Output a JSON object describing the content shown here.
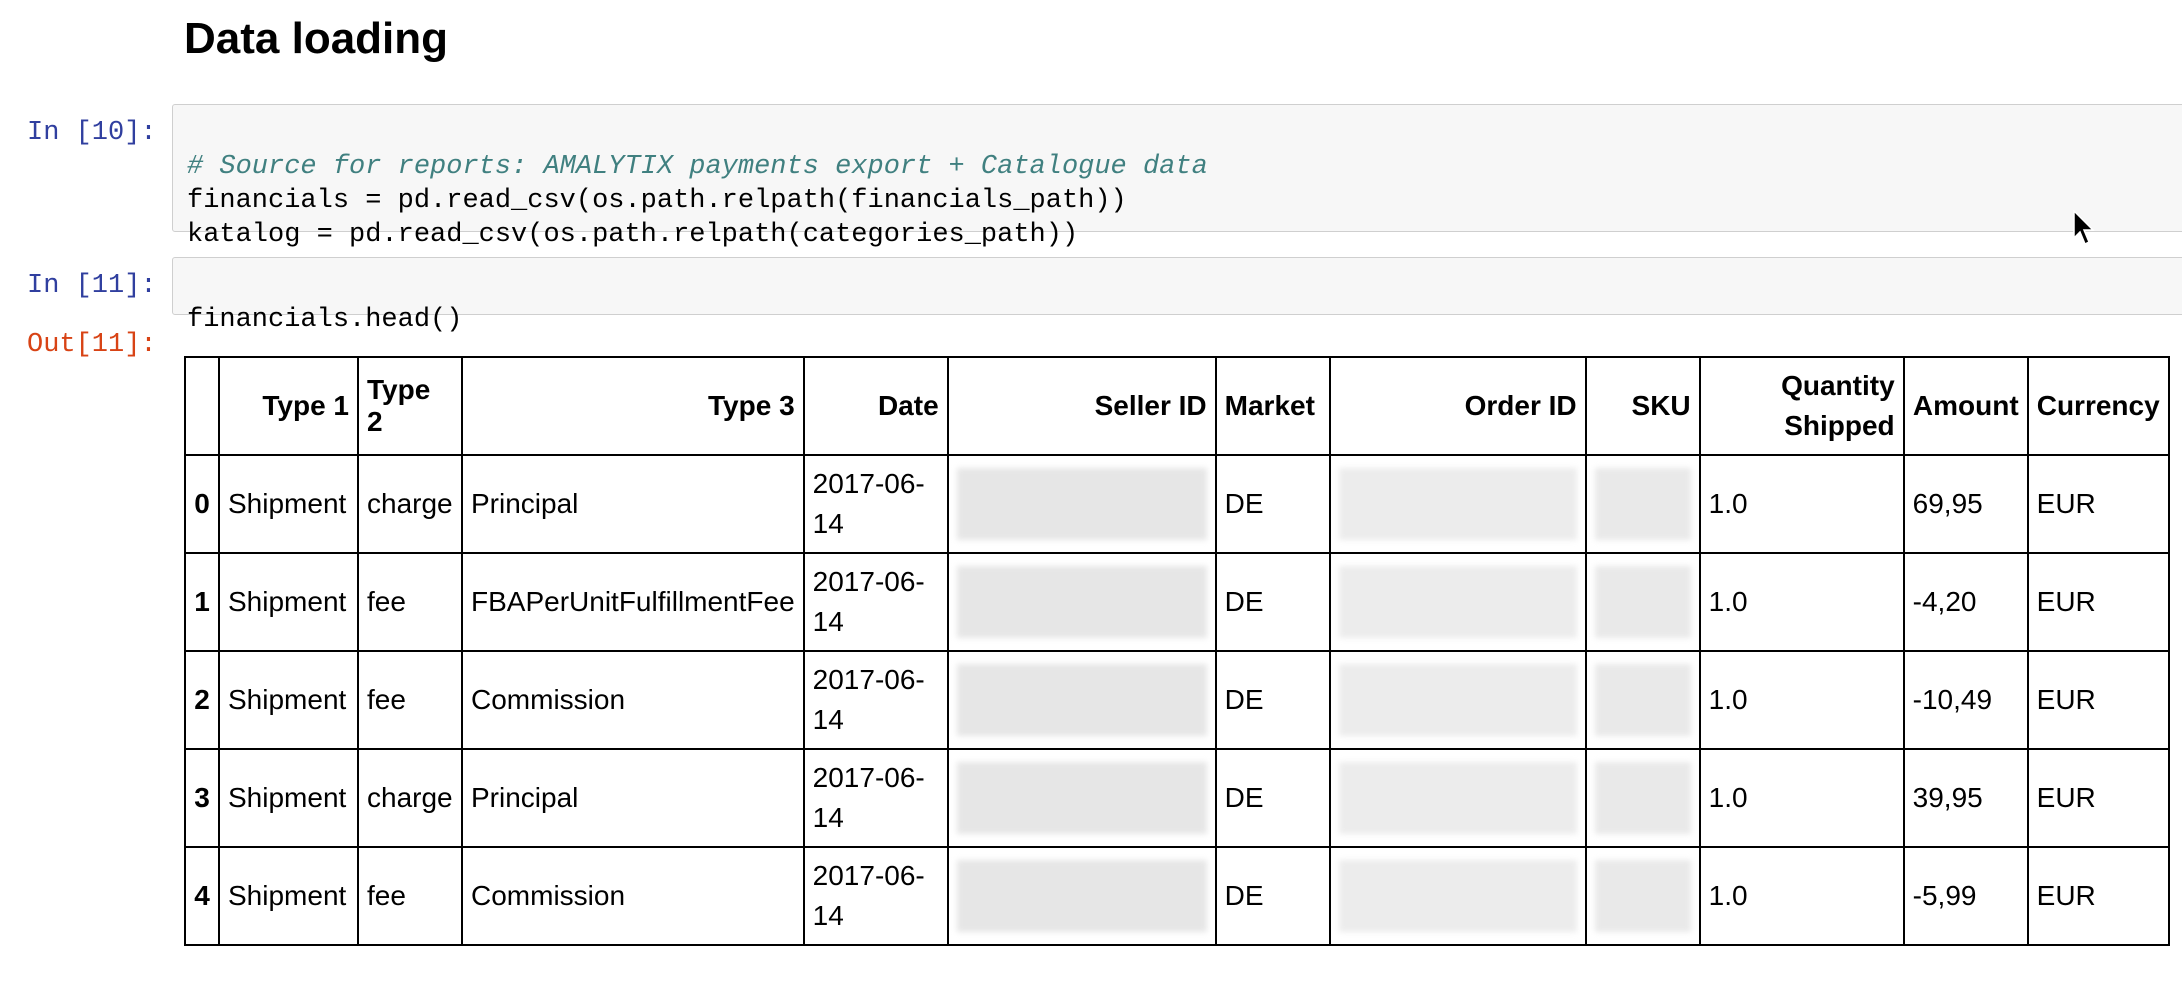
{
  "heading": "Data loading",
  "cells": [
    {
      "prompt": "In [10]:",
      "lines": [
        {
          "text": "# Source for reports: AMALYTIX payments export + Catalogue data",
          "comment": true
        },
        {
          "text": "financials = pd.read_csv(os.path.relpath(financials_path))",
          "comment": false
        },
        {
          "text": "katalog = pd.read_csv(os.path.relpath(categories_path))",
          "comment": false
        }
      ]
    },
    {
      "prompt": "In [11]:",
      "lines": [
        {
          "text": "financials.head()",
          "comment": false
        }
      ]
    }
  ],
  "output": {
    "prompt": "Out[11]:",
    "table": {
      "columns": [
        "",
        "Type 1",
        "Type 2",
        "Type 3",
        "Date",
        "Seller ID",
        "Market",
        "Order ID",
        "SKU",
        "Quantity Shipped",
        "Amount",
        "Currency"
      ],
      "rows": [
        {
          "idx": "0",
          "type1": "Shipment",
          "type2": "charge",
          "type3": "Principal",
          "date": "2017-06-14",
          "seller": "",
          "market": "DE",
          "order": "",
          "sku": "",
          "qty": "1.0",
          "amount": "69,95",
          "currency": "EUR"
        },
        {
          "idx": "1",
          "type1": "Shipment",
          "type2": "fee",
          "type3": "FBAPerUnitFulfillmentFee",
          "date": "2017-06-14",
          "seller": "",
          "market": "DE",
          "order": "",
          "sku": "",
          "qty": "1.0",
          "amount": "-4,20",
          "currency": "EUR"
        },
        {
          "idx": "2",
          "type1": "Shipment",
          "type2": "fee",
          "type3": "Commission",
          "date": "2017-06-14",
          "seller": "",
          "market": "DE",
          "order": "",
          "sku": "",
          "qty": "1.0",
          "amount": "-10,49",
          "currency": "EUR"
        },
        {
          "idx": "3",
          "type1": "Shipment",
          "type2": "charge",
          "type3": "Principal",
          "date": "2017-06-14",
          "seller": "",
          "market": "DE",
          "order": "",
          "sku": "",
          "qty": "1.0",
          "amount": "39,95",
          "currency": "EUR"
        },
        {
          "idx": "4",
          "type1": "Shipment",
          "type2": "fee",
          "type3": "Commission",
          "date": "2017-06-14",
          "seller": "",
          "market": "DE",
          "order": "",
          "sku": "",
          "qty": "1.0",
          "amount": "-5,99",
          "currency": "EUR"
        }
      ]
    }
  },
  "colors": {
    "in_prompt": "#303f9f",
    "out_prompt": "#d84315",
    "comment": "#408080",
    "cell_bg": "#f7f7f7"
  },
  "icons": [
    "mouse-cursor-icon"
  ]
}
